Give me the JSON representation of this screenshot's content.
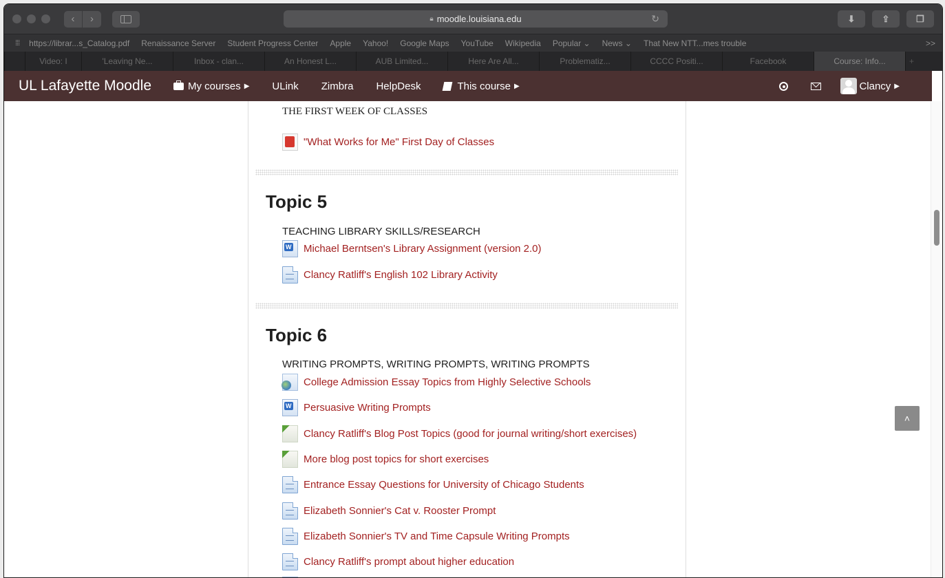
{
  "browser": {
    "url": "moodle.louisiana.edu",
    "favorites": [
      "https://librar...s_Catalog.pdf",
      "Renaissance Server",
      "Student Progress Center",
      "Apple",
      "Yahoo!",
      "Google Maps",
      "YouTube",
      "Wikipedia",
      "Popular ⌄",
      "News ⌄",
      "That New NTT...mes trouble"
    ],
    "more": ">>",
    "tabs": [
      {
        "label": "Video: I",
        "active": false
      },
      {
        "label": "'Leaving Ne...",
        "active": false
      },
      {
        "label": "Inbox - clan...",
        "active": false
      },
      {
        "label": "An Honest L...",
        "active": false
      },
      {
        "label": "AUB Limited...",
        "active": false
      },
      {
        "label": "Here Are All...",
        "active": false
      },
      {
        "label": "Problematiz...",
        "active": false
      },
      {
        "label": "CCCC Positi...",
        "active": false
      },
      {
        "label": "Facebook",
        "active": false
      },
      {
        "label": "Course: Info...",
        "active": true
      }
    ]
  },
  "moodle": {
    "brand": "UL Lafayette Moodle",
    "nav": {
      "my_courses": "My courses",
      "ulink": "ULink",
      "zimbra": "Zimbra",
      "helpdesk": "HelpDesk",
      "this_course": "This course"
    },
    "user": "Clancy"
  },
  "content": {
    "week_summary": "THE FIRST WEEK OF CLASSES",
    "week_activities": [
      {
        "label": "\"What Works for Me\" First Day of Classes",
        "icon": "pdf-icon"
      }
    ],
    "topic5": {
      "title": "Topic 5",
      "summary": "TEACHING LIBRARY SKILLS/RESEARCH",
      "activities": [
        {
          "label": "Michael Berntsen's Library Assignment (version 2.0)",
          "icon": "word-doc-icon"
        },
        {
          "label": "Clancy Ratliff's English 102 Library Activity",
          "icon": "page-icon"
        }
      ]
    },
    "topic6": {
      "title": "Topic 6",
      "summary": "WRITING PROMPTS, WRITING PROMPTS, WRITING PROMPTS",
      "activities": [
        {
          "label": "College Admission Essay Topics from Highly Selective Schools",
          "icon": "url-icon"
        },
        {
          "label": "Persuasive Writing Prompts",
          "icon": "word-doc-icon"
        },
        {
          "label": "Clancy Ratliff's Blog Post Topics (good for journal writing/short exercises)",
          "icon": "blog-icon"
        },
        {
          "label": "More blog post topics for short exercises",
          "icon": "blog-icon"
        },
        {
          "label": "Entrance Essay Questions for University of Chicago Students",
          "icon": "page-icon"
        },
        {
          "label": "Elizabeth Sonnier's Cat v. Rooster Prompt",
          "icon": "page-icon"
        },
        {
          "label": "Elizabeth Sonnier's TV and Time Capsule Writing Prompts",
          "icon": "page-icon"
        },
        {
          "label": "Clancy Ratliff's prompt about higher education",
          "icon": "page-icon"
        }
      ]
    }
  },
  "colors": {
    "navbar": "#4b3131",
    "link": "#a32121"
  }
}
